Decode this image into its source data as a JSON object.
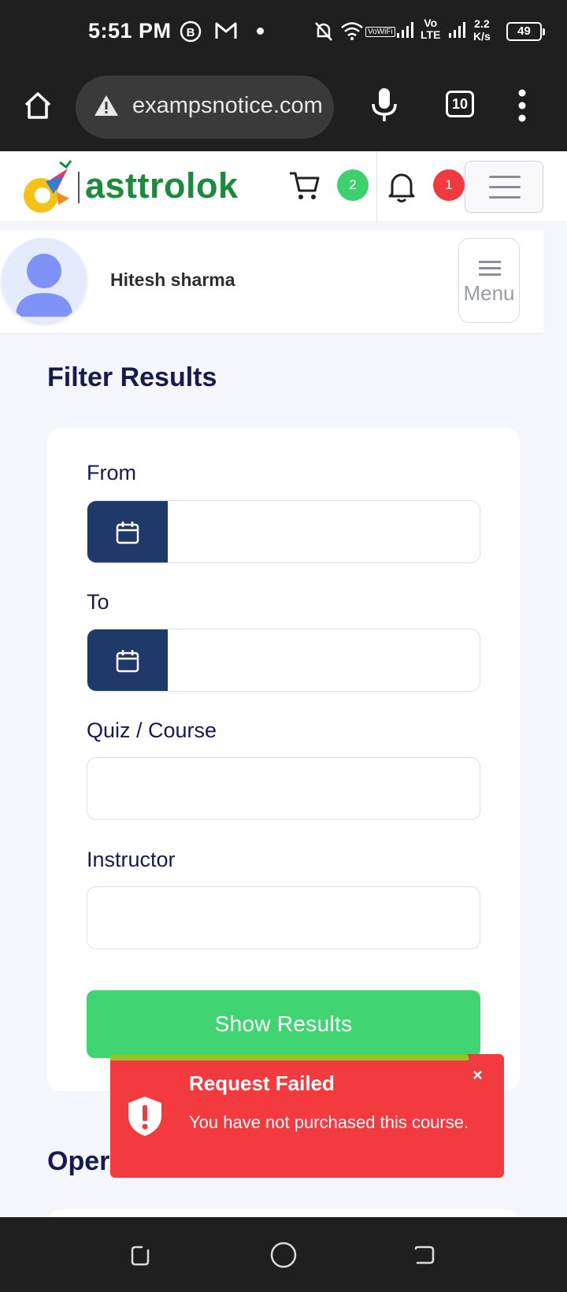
{
  "status_bar": {
    "time": "5:51 PM",
    "network_speed_value": "2.2",
    "network_speed_unit": "K/s",
    "battery": "49",
    "volte_top": "Vo",
    "volte_bottom": "LTE",
    "vowifi": "VoWiFi"
  },
  "browser": {
    "url": "exampsnotice.com",
    "tab_count": "10"
  },
  "site_header": {
    "logo_text": "asttrolok",
    "cart_count": "2",
    "notification_count": "1",
    "colors": {
      "logo_green": "#1c8a3c",
      "cart_badge": "#3ecf6e",
      "notif_badge": "#f03a3e"
    }
  },
  "profile": {
    "name": "Hitesh sharma",
    "menu_label": "Menu"
  },
  "filter": {
    "title": "Filter Results",
    "from_label": "From",
    "to_label": "To",
    "quiz_label": "Quiz / Course",
    "instructor_label": "Instructor",
    "from_value": "",
    "to_value": "",
    "quiz_value": "",
    "instructor_value": "",
    "show_button": "Show Results",
    "colors": {
      "date_button": "#1f3a68",
      "primary_button": "#41d473",
      "heading": "#141b4d"
    }
  },
  "next_section": {
    "title_partial": "Oper"
  },
  "toast": {
    "title": "Request Failed",
    "message": "You have not purchased this course.",
    "close": "×",
    "colors": {
      "background": "#f33a3f",
      "progress": "#8fc62a"
    }
  }
}
